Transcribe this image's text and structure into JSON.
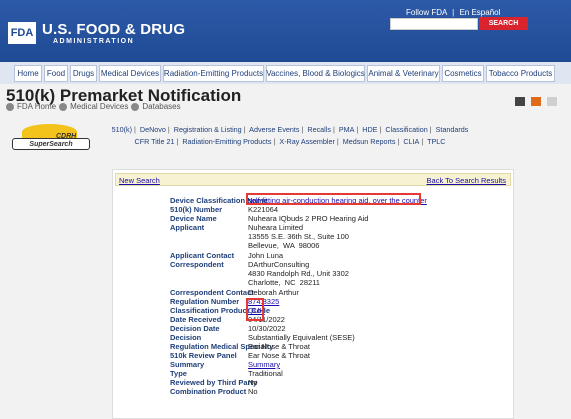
{
  "header": {
    "logo_box": "FDA",
    "name_line1": "U.S. FOOD & DRUG",
    "name_line2": "ADMINISTRATION",
    "follow": "Follow FDA",
    "espanol": "En Español",
    "search_btn": "SEARCH"
  },
  "nav": {
    "tabs": [
      "Home",
      "Food",
      "Drugs",
      "Medical Devices",
      "Radiation-Emitting Products",
      "Vaccines, Blood & Biologics",
      "Animal & Veterinary",
      "Cosmetics",
      "Tobacco Products"
    ]
  },
  "page": {
    "title": "510(k) Premarket Notification",
    "crumbs": [
      "FDA Home",
      "Medical Devices",
      "Databases"
    ]
  },
  "logo": {
    "word1": "CDRH",
    "word2": "SuperSearch"
  },
  "sublinks": {
    "row1": [
      "510(k)",
      "DeNovo",
      "Registration & Listing",
      "Adverse Events",
      "Recalls",
      "PMA",
      "HDE",
      "Classification",
      "Standards"
    ],
    "row2": [
      "CFR Title 21",
      "Radiation-Emitting Products",
      "X-Ray Assembler",
      "Medsun Reports",
      "CLIA",
      "TPLC"
    ]
  },
  "panel": {
    "new_search": "New Search",
    "back": "Back To Search Results"
  },
  "fields": [
    {
      "label": "Device Classification Name",
      "value": "self-fitting air-conduction hearing aid, over the counter",
      "link": true
    },
    {
      "label": "510(k) Number",
      "value": "K221064"
    },
    {
      "label": "Device Name",
      "value": "Nuheara IQbuds 2 PRO Hearing Aid"
    },
    {
      "label": "Applicant",
      "value": "Nuheara Limited\n13555 S.E. 36th St., Suite 100\nBellevue,  WA  98006"
    },
    {
      "label": "Applicant Contact",
      "value": "John Luna"
    },
    {
      "label": "Correspondent",
      "value": "DArthurConsulting\n4830 Randolph Rd., Unit 3302\nCharlotte,  NC  28211"
    },
    {
      "label": "Correspondent Contact",
      "value": "Deborah Arthur"
    },
    {
      "label": "Regulation Number",
      "value": "874.3325",
      "link": true
    },
    {
      "label": "Classification Product Code",
      "value": "QUH",
      "link": true
    },
    {
      "label": "Date Received",
      "value": "04/11/2022"
    },
    {
      "label": "Decision Date",
      "value": "10/30/2022"
    },
    {
      "label": "Decision",
      "value": "Substantially Equivalent (SESE)"
    },
    {
      "label": "Regulation Medical Specialty",
      "value": "Ear Nose & Throat"
    },
    {
      "label": "510k Review Panel",
      "value": "Ear Nose & Throat"
    },
    {
      "label": "Summary",
      "value": "Summary",
      "link": true
    },
    {
      "label": "Type",
      "value": "Traditional"
    },
    {
      "label": "Reviewed by Third Party",
      "value": "No"
    },
    {
      "label": "Combination Product",
      "value": "No"
    }
  ]
}
